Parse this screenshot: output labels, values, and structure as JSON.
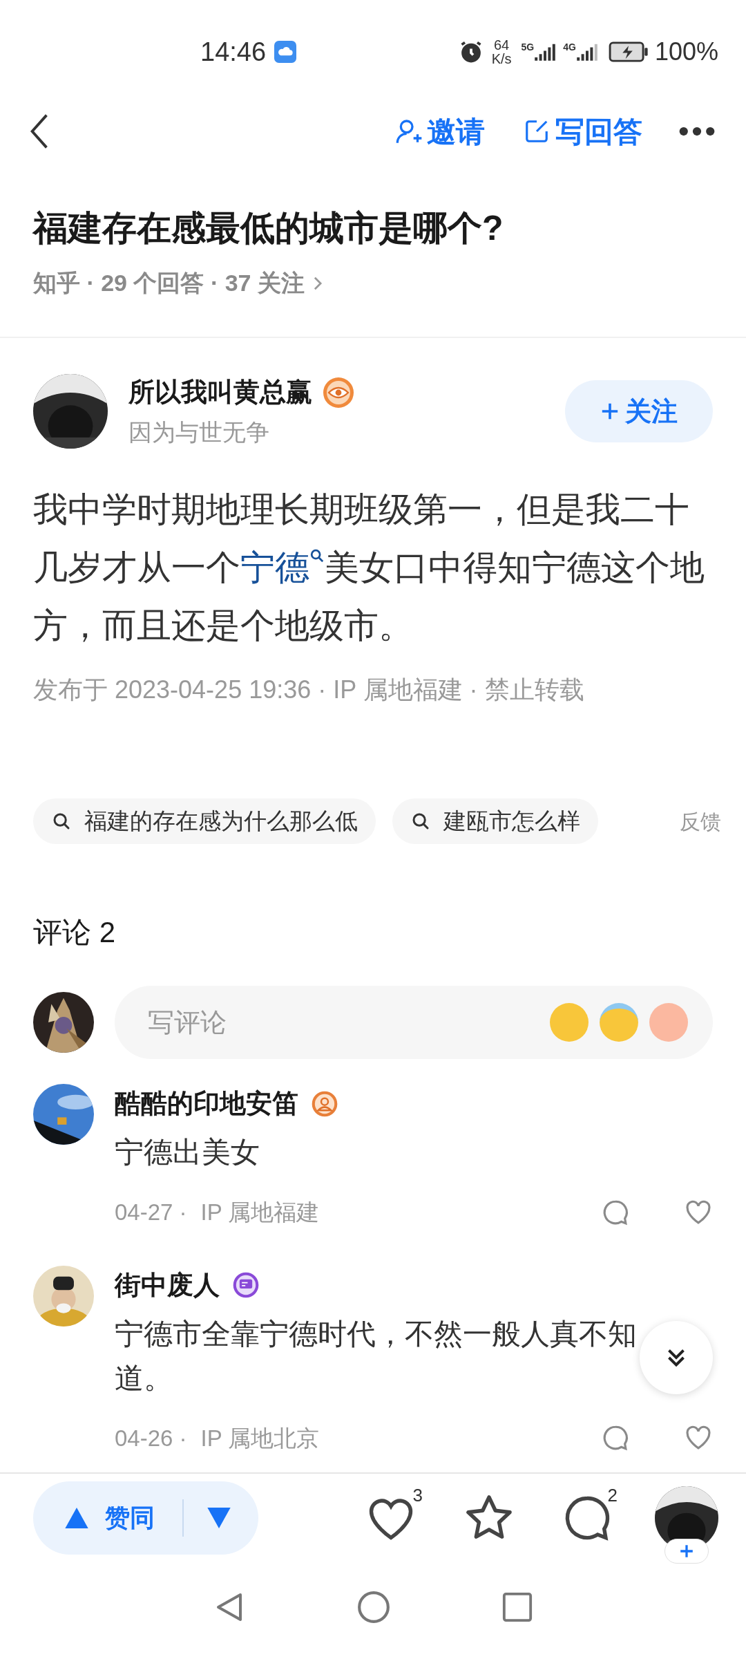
{
  "status_bar": {
    "time": "14:46",
    "net_speed": "64",
    "net_unit": "K/s",
    "signal_1": "5G",
    "signal_2": "4G",
    "battery": "100%"
  },
  "nav": {
    "invite": "邀请",
    "write_answer": "写回答"
  },
  "question": {
    "title": "福建存在感最低的城市是哪个?",
    "meta": "知乎 · 29 个回答 · 37 关注"
  },
  "answer": {
    "author": "所以我叫黄总赢",
    "bio": "因为与世无争",
    "follow": "关注",
    "body_before": "我中学时期地理长期班级第一，但是我二十几岁才从一个",
    "body_link": "宁德",
    "body_after": "美女口中得知宁德这个地方，而且还是个地级市。",
    "published": "发布于 2023-04-25 19:36 · IP 属地福建 · 禁止转载"
  },
  "related_searches": [
    "福建的存在感为什么那么低",
    "建瓯市怎么样"
  ],
  "feedback": "反馈",
  "comments_header": "评论 2",
  "comment_input": {
    "placeholder": "写评论"
  },
  "comments": [
    {
      "name": "酷酷的印地安笛",
      "kind": "person",
      "text": "宁德出美女",
      "date": "04-27 ·",
      "location": "IP 属地福建"
    },
    {
      "name": "街中废人",
      "kind": "chat",
      "text": "宁德市全靠宁德时代，不然一般人真不知道。",
      "date": "04-26 ·",
      "location": "IP 属地北京"
    }
  ],
  "bottom_bar": {
    "vote": "赞同",
    "likes": "3",
    "comments": "2"
  }
}
